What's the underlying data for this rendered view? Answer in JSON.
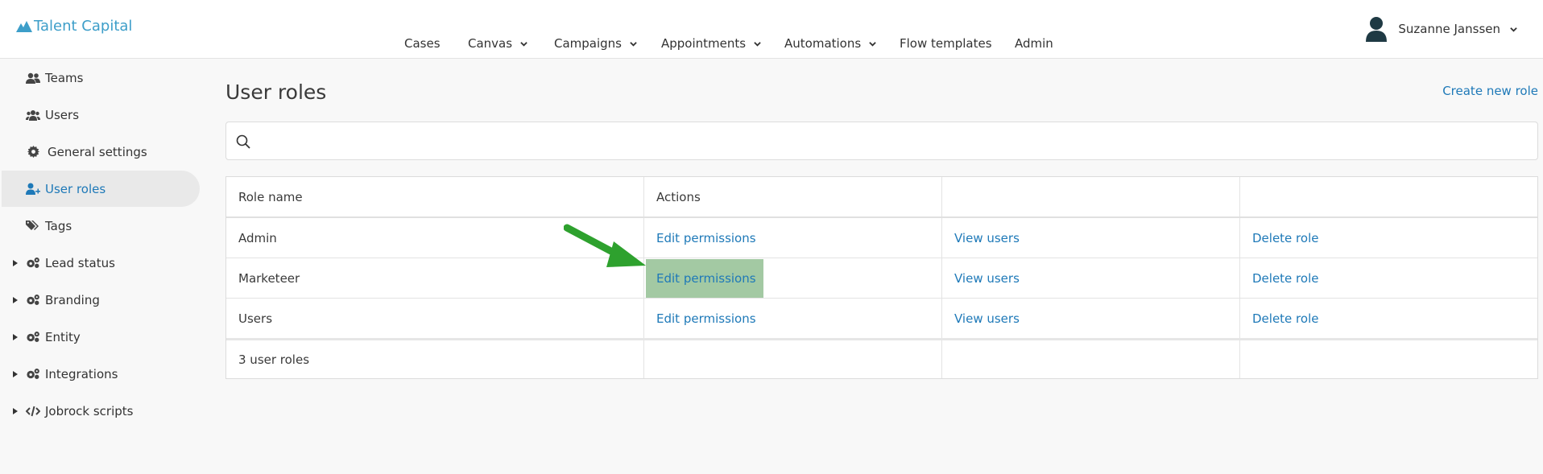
{
  "app": {
    "name": "Talent Capital"
  },
  "topnav": {
    "items": [
      {
        "label": "Cases",
        "dropdown": false
      },
      {
        "label": "Canvas",
        "dropdown": true
      },
      {
        "label": "Campaigns",
        "dropdown": true
      },
      {
        "label": "Appointments",
        "dropdown": true
      },
      {
        "label": "Automations",
        "dropdown": true
      },
      {
        "label": "Flow templates",
        "dropdown": false
      },
      {
        "label": "Admin",
        "dropdown": false
      }
    ]
  },
  "user": {
    "name": "Suzanne Janssen"
  },
  "sidebar": {
    "items": [
      {
        "label": "Teams",
        "icon": "teams-icon",
        "expandable": false,
        "active": false
      },
      {
        "label": "Users",
        "icon": "users-icon",
        "expandable": false,
        "active": false
      },
      {
        "label": "General settings",
        "icon": "gear-icon",
        "expandable": false,
        "active": false
      },
      {
        "label": "User roles",
        "icon": "user-role-icon",
        "expandable": false,
        "active": true
      },
      {
        "label": "Tags",
        "icon": "tags-icon",
        "expandable": false,
        "active": false
      },
      {
        "label": "Lead status",
        "icon": "cogs-icon",
        "expandable": true,
        "active": false
      },
      {
        "label": "Branding",
        "icon": "cogs-icon",
        "expandable": true,
        "active": false
      },
      {
        "label": "Entity",
        "icon": "cogs-icon",
        "expandable": true,
        "active": false
      },
      {
        "label": "Integrations",
        "icon": "cogs-icon",
        "expandable": true,
        "active": false
      },
      {
        "label": "Jobrock scripts",
        "icon": "code-icon",
        "expandable": true,
        "active": false
      }
    ]
  },
  "main": {
    "title": "User roles",
    "create_label": "Create new role",
    "search": {
      "value": "",
      "placeholder": ""
    },
    "table": {
      "headers": [
        "Role name",
        "Actions",
        "",
        ""
      ],
      "rows": [
        {
          "name": "Admin",
          "edit": "Edit permissions",
          "view": "View users",
          "delete": "Delete role"
        },
        {
          "name": "Marketeer",
          "edit": "Edit permissions",
          "view": "View users",
          "delete": "Delete role"
        },
        {
          "name": "Users",
          "edit": "Edit permissions",
          "view": "View users",
          "delete": "Delete role"
        }
      ],
      "footer": "3 user roles"
    }
  },
  "colors": {
    "brand": "#3d9ec9",
    "link": "#1e79b8",
    "highlight": "#a3c9a3",
    "arrow": "#2ea12e"
  }
}
